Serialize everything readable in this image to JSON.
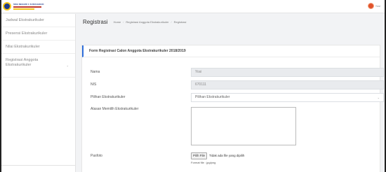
{
  "header": {
    "logo_text": "SMA NEGERI 1 SUKOHARJO",
    "user_name": "Yosi"
  },
  "sidebar": {
    "items": [
      {
        "label": "Jadwal Ekstrakurikuler"
      },
      {
        "label": "Presensi Ekstrakurikuler"
      },
      {
        "label": "Nilai Ekstrakurikuler"
      },
      {
        "label_line1": "Registrasi Anggota",
        "label_line2": "Ekstrakurikuler",
        "chevron": "chevron-down-icon"
      }
    ]
  },
  "page": {
    "title": "Registrasi",
    "breadcrumb": [
      "Home",
      "Registrasi Anggota Ekstrakurikuler",
      "Registrasi"
    ]
  },
  "form": {
    "header": "Form Registrasi Calon Anggota Ekstrakurikuler 2018/2019",
    "nama": {
      "label": "Nama",
      "value": "Yosi"
    },
    "nis": {
      "label": "NIS",
      "value": "670111"
    },
    "pilihan": {
      "label": "Pilihan Ekstrakurikuler",
      "value": "Pilihan Ekstrakurikuler"
    },
    "alasan": {
      "label": "Alasan Memilih Ekstrakurikuler",
      "value": ""
    },
    "pasfoto": {
      "label": "Pasfoto",
      "button": "Pilih File",
      "status": "Tidak ada file yang dipilih",
      "hint": "Format file : jpg/png"
    }
  },
  "colors": {
    "accent": "#2f6fdb",
    "header_bg": "#ffffff",
    "page_bg": "#f2f3f5"
  }
}
